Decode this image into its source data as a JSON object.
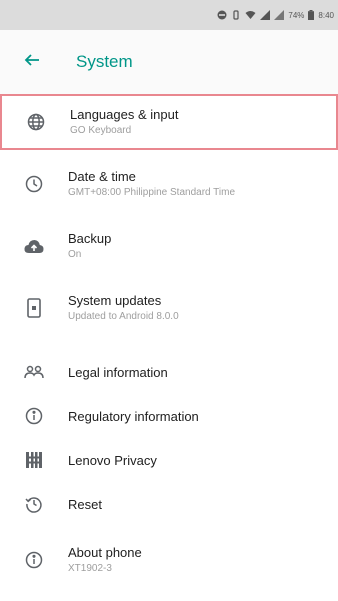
{
  "status_bar": {
    "battery": "74%",
    "time": "8:40"
  },
  "app_bar": {
    "title": "System"
  },
  "items": [
    {
      "title": "Languages & input",
      "subtitle": "GO Keyboard",
      "icon": "globe-icon"
    },
    {
      "title": "Date & time",
      "subtitle": "GMT+08:00 Philippine Standard Time",
      "icon": "clock-icon"
    },
    {
      "title": "Backup",
      "subtitle": "On",
      "icon": "cloud-upload-icon"
    },
    {
      "title": "System updates",
      "subtitle": "Updated to Android 8.0.0",
      "icon": "phone-update-icon"
    },
    {
      "title": "Legal information",
      "icon": "people-icon"
    },
    {
      "title": "Regulatory information",
      "icon": "info-icon"
    },
    {
      "title": "Lenovo Privacy",
      "icon": "privacy-grid-icon"
    },
    {
      "title": "Reset",
      "icon": "restore-icon"
    },
    {
      "title": "About phone",
      "subtitle": "XT1902-3",
      "icon": "info-icon"
    }
  ],
  "colors": {
    "accent": "#009688",
    "highlight_border": "#e9878f",
    "status_bar_bg": "#dcdcdc"
  }
}
